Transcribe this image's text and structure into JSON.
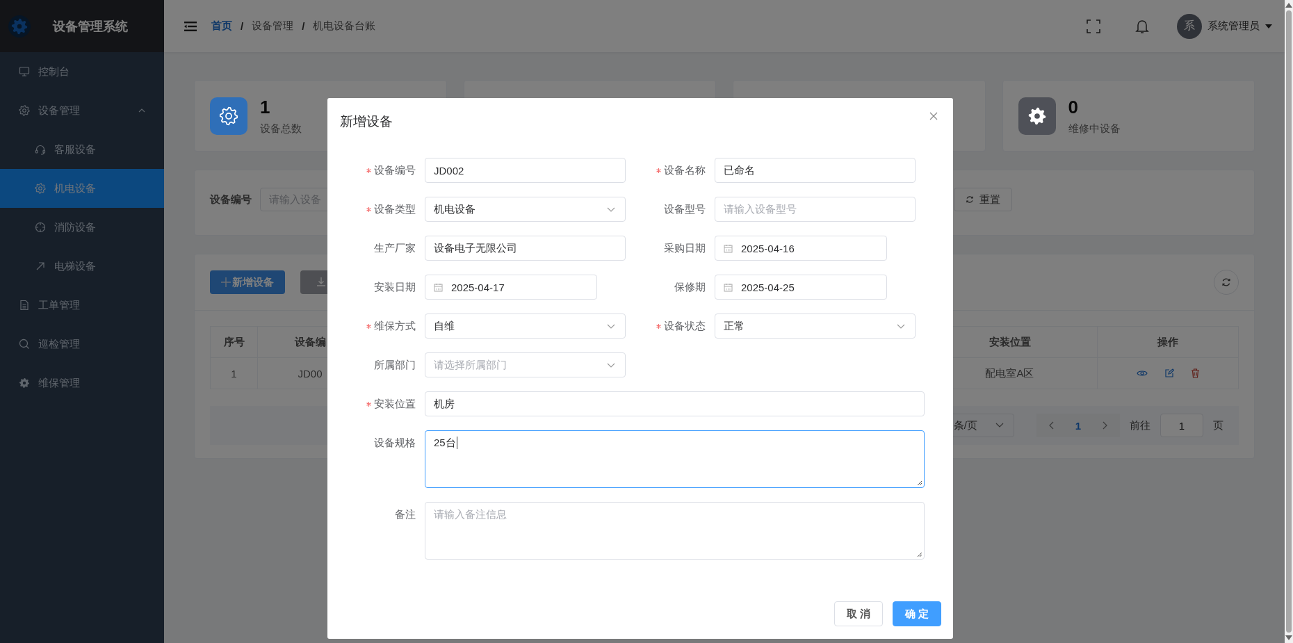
{
  "sidebar": {
    "title": "设备管理系统",
    "items": [
      {
        "label": "控制台",
        "selected": false
      },
      {
        "label": "设备管理",
        "selected": false,
        "expanded": true,
        "children": [
          {
            "label": "客服设备",
            "selected": false
          },
          {
            "label": "机电设备",
            "selected": true
          },
          {
            "label": "消防设备",
            "selected": false
          },
          {
            "label": "电梯设备",
            "selected": false
          }
        ]
      },
      {
        "label": "工单管理",
        "selected": false
      },
      {
        "label": "巡检管理",
        "selected": false
      },
      {
        "label": "维保管理",
        "selected": false
      }
    ]
  },
  "header": {
    "separator": "/",
    "breadcrumb": [
      {
        "label": "首页",
        "kind": "link"
      },
      {
        "label": "设备管理",
        "kind": "text"
      },
      {
        "label": "机电设备台账",
        "kind": "text"
      }
    ],
    "user": {
      "avatar": "系",
      "name": "系统管理员"
    }
  },
  "stats": [
    {
      "value": "1",
      "label": "设备总数",
      "color": "#2f6fb8"
    },
    {
      "value": "0",
      "label": "维修中设备",
      "color": "#4f5158"
    }
  ],
  "filter": {
    "label": "设备编号",
    "placeholder": "请输入设备",
    "reset_label": "重置"
  },
  "toolbar": {
    "add_label": "新增设备"
  },
  "table": {
    "columns": [
      "序号",
      "设备编",
      "安装位置",
      "操作"
    ],
    "rows": [
      {
        "cells": [
          "1",
          "JD00",
          "配电室A区"
        ]
      }
    ]
  },
  "pagination": {
    "page_size": "条/页",
    "current": "1",
    "goto_label": "前往",
    "goto_value": "1",
    "page_unit": "页"
  },
  "dialog": {
    "title": "新增设备",
    "fields": [
      {
        "label": "设备编号",
        "required": true,
        "kind": "input",
        "wide": false,
        "focused": false,
        "value": "JD002"
      },
      {
        "label": "设备名称",
        "required": true,
        "kind": "input",
        "wide": false,
        "focused": false,
        "value": "已命名"
      },
      {
        "label": "设备类型",
        "required": true,
        "kind": "select",
        "wide": false,
        "focused": false,
        "value": "机电设备"
      },
      {
        "label": "设备型号",
        "required": false,
        "kind": "input",
        "wide": false,
        "focused": false,
        "placeholder": "请输入设备型号"
      },
      {
        "label": "生产厂家",
        "required": false,
        "kind": "input",
        "wide": false,
        "focused": false,
        "value": "设备电子无限公司"
      },
      {
        "label": "采购日期",
        "required": false,
        "kind": "date",
        "wide": false,
        "focused": false,
        "value": "2025-04-16"
      },
      {
        "label": "安装日期",
        "required": false,
        "kind": "date",
        "wide": false,
        "focused": false,
        "value": "2025-04-17"
      },
      {
        "label": "保修期",
        "required": false,
        "kind": "date",
        "wide": false,
        "focused": false,
        "value": "2025-04-25"
      },
      {
        "label": "维保方式",
        "required": true,
        "kind": "select",
        "wide": false,
        "focused": false,
        "value": "自维"
      },
      {
        "label": "设备状态",
        "required": true,
        "kind": "select",
        "wide": false,
        "focused": false,
        "value": "正常"
      },
      {
        "label": "所属部门",
        "required": false,
        "kind": "select",
        "wide": false,
        "focused": false,
        "placeholder": "请选择所属部门"
      },
      {
        "label": "安装位置",
        "required": true,
        "kind": "input",
        "wide": true,
        "focused": false,
        "value": "机房"
      },
      {
        "label": "设备规格",
        "required": false,
        "kind": "textarea",
        "wide": true,
        "focused": true,
        "value": "25台"
      },
      {
        "label": "备注",
        "required": false,
        "kind": "textarea",
        "wide": true,
        "focused": false,
        "placeholder": "请输入备注信息"
      }
    ],
    "buttons": [
      {
        "label": "取 消",
        "kind": "secondary"
      },
      {
        "label": "确 定",
        "kind": "primary"
      }
    ]
  }
}
